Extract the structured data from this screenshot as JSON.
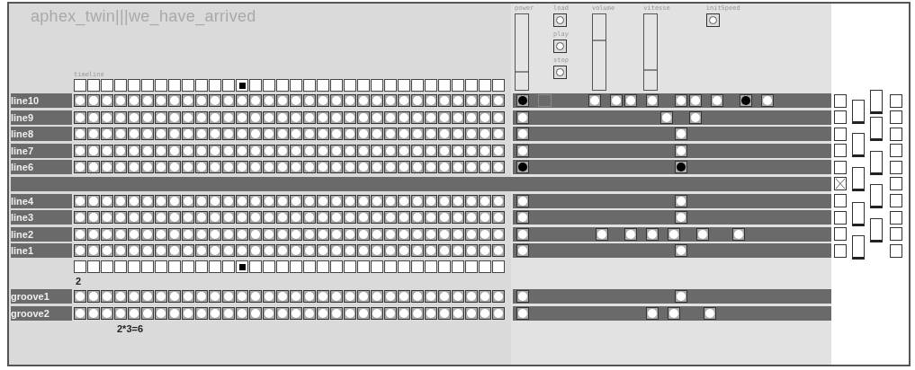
{
  "title": "aphex_twin|||we_have_arrived",
  "timeline": {
    "label": "timeline",
    "steps": [
      false,
      false,
      false,
      false,
      false,
      false,
      false,
      false,
      false,
      false,
      false,
      false,
      true,
      false,
      false,
      false,
      false,
      false,
      false,
      false,
      false,
      false,
      false,
      false,
      false,
      false,
      false,
      false,
      false,
      false,
      false,
      false
    ]
  },
  "controls": [
    {
      "kind": "slider",
      "label": "power",
      "level": 0.23
    },
    {
      "kind": "stack",
      "items": [
        {
          "label": "load"
        },
        {
          "label": "play"
        },
        {
          "label": "stop"
        }
      ]
    },
    {
      "kind": "slider",
      "label": "volume",
      "level": 0.64
    },
    {
      "kind": "slider",
      "label": "vitesse",
      "level": 0.25
    },
    {
      "kind": "stack",
      "items": [
        {
          "label": "initSpeed"
        }
      ]
    }
  ],
  "rows": [
    {
      "label": "line10",
      "steps": [
        false,
        false,
        false,
        false,
        false,
        false,
        false,
        false,
        false,
        false,
        false,
        false,
        false,
        false,
        false,
        false,
        false,
        false,
        false,
        false,
        false,
        false,
        false,
        false,
        false,
        false,
        false,
        false,
        false,
        false,
        false,
        false
      ],
      "power": true,
      "crossed": false,
      "checked": false,
      "cells": [
        {
          "kind": "box"
        },
        {
          "kind": "toggle",
          "on": false
        },
        {
          "kind": "toggle",
          "on": false
        },
        {
          "kind": "toggle",
          "on": false
        },
        {
          "kind": "toggle",
          "on": false
        },
        {
          "kind": "toggle",
          "on": false
        },
        {
          "kind": "toggle",
          "on": false
        },
        {
          "kind": "toggle",
          "on": false
        },
        {
          "kind": "toggle",
          "on": true
        },
        {
          "kind": "toggle",
          "on": false
        }
      ]
    },
    {
      "label": "line9",
      "steps": [
        false,
        false,
        false,
        false,
        false,
        false,
        false,
        false,
        false,
        false,
        false,
        false,
        false,
        false,
        false,
        false,
        false,
        false,
        false,
        false,
        false,
        false,
        false,
        false,
        false,
        false,
        false,
        false,
        false,
        false,
        false,
        false
      ],
      "power": false,
      "crossed": false,
      "checked": false,
      "cells": [
        {
          "kind": "toggle",
          "on": false
        },
        {
          "kind": "toggle",
          "on": false
        }
      ]
    },
    {
      "label": "line8",
      "steps": [
        false,
        false,
        false,
        false,
        false,
        false,
        false,
        false,
        false,
        false,
        false,
        false,
        false,
        false,
        false,
        false,
        false,
        false,
        false,
        false,
        false,
        false,
        false,
        false,
        false,
        false,
        false,
        false,
        false,
        false,
        false,
        false
      ],
      "power": false,
      "crossed": false,
      "checked": false,
      "cells": [
        {
          "kind": "toggle",
          "on": false
        }
      ]
    },
    {
      "label": "line7",
      "steps": [
        false,
        false,
        false,
        false,
        false,
        false,
        false,
        false,
        false,
        false,
        false,
        false,
        false,
        false,
        false,
        false,
        false,
        false,
        false,
        false,
        false,
        false,
        false,
        false,
        false,
        false,
        false,
        false,
        false,
        false,
        false,
        false
      ],
      "power": false,
      "crossed": false,
      "checked": false,
      "cells": [
        {
          "kind": "toggle",
          "on": false
        }
      ]
    },
    {
      "label": "line6",
      "steps": [
        false,
        false,
        false,
        false,
        false,
        false,
        false,
        false,
        false,
        false,
        false,
        false,
        false,
        false,
        false,
        false,
        false,
        false,
        false,
        false,
        false,
        false,
        false,
        false,
        false,
        false,
        false,
        false,
        false,
        false,
        false,
        false
      ],
      "power": true,
      "crossed": false,
      "checked": false,
      "cells": [
        {
          "kind": "toggle",
          "on": true
        }
      ]
    },
    {
      "crossed": true,
      "checked": false
    },
    {
      "label": "line4",
      "steps": [
        false,
        false,
        false,
        false,
        false,
        false,
        false,
        false,
        false,
        false,
        false,
        false,
        false,
        false,
        false,
        false,
        false,
        false,
        false,
        false,
        false,
        false,
        false,
        false,
        false,
        false,
        false,
        false,
        false,
        false,
        false,
        false
      ],
      "power": false,
      "crossed": false,
      "checked": false,
      "cells": [
        {
          "kind": "toggle",
          "on": false
        }
      ]
    },
    {
      "label": "line3",
      "steps": [
        false,
        false,
        false,
        false,
        false,
        false,
        false,
        false,
        false,
        false,
        false,
        false,
        false,
        false,
        false,
        false,
        false,
        false,
        false,
        false,
        false,
        false,
        false,
        false,
        false,
        false,
        false,
        false,
        false,
        false,
        false,
        false
      ],
      "power": false,
      "crossed": false,
      "checked": false,
      "cells": [
        {
          "kind": "toggle",
          "on": false
        }
      ]
    },
    {
      "label": "line2",
      "steps": [
        false,
        false,
        false,
        false,
        false,
        false,
        false,
        false,
        false,
        false,
        false,
        false,
        false,
        false,
        false,
        false,
        false,
        false,
        false,
        false,
        false,
        false,
        false,
        false,
        false,
        false,
        false,
        false,
        false,
        false,
        false,
        false
      ],
      "power": false,
      "crossed": false,
      "checked": false,
      "cells": [
        {
          "kind": "toggle",
          "on": false
        },
        {
          "kind": "toggle",
          "on": false
        },
        {
          "kind": "toggle",
          "on": false
        },
        {
          "kind": "toggle",
          "on": false
        },
        {
          "kind": "toggle",
          "on": false
        },
        {
          "kind": "toggle",
          "on": false
        }
      ]
    },
    {
      "label": "line1",
      "steps": [
        false,
        false,
        false,
        false,
        false,
        false,
        false,
        false,
        false,
        false,
        false,
        false,
        false,
        false,
        false,
        false,
        false,
        false,
        false,
        false,
        false,
        false,
        false,
        false,
        false,
        false,
        false,
        false,
        false,
        false,
        false,
        false
      ],
      "power": false,
      "crossed": false,
      "checked": false,
      "cells": [
        {
          "kind": "toggle",
          "on": false
        }
      ]
    }
  ],
  "timeline_bottom": {
    "steps": [
      false,
      false,
      false,
      false,
      false,
      false,
      false,
      false,
      false,
      false,
      false,
      false,
      true,
      false,
      false,
      false,
      false,
      false,
      false,
      false,
      false,
      false,
      false,
      false,
      false,
      false,
      false,
      false,
      false,
      false,
      false,
      false
    ]
  },
  "counter": "2",
  "grooves": [
    {
      "label": "groove1",
      "steps": [
        false,
        false,
        false,
        false,
        false,
        false,
        false,
        false,
        false,
        false,
        false,
        false,
        false,
        false,
        false,
        false,
        false,
        false,
        false,
        false,
        false,
        false,
        false,
        false,
        false,
        false,
        false,
        false,
        false,
        false,
        false,
        false
      ],
      "power": false,
      "cells": [
        {
          "kind": "toggle",
          "on": false
        }
      ]
    },
    {
      "label": "groove2",
      "steps": [
        false,
        false,
        false,
        false,
        false,
        false,
        false,
        false,
        false,
        false,
        false,
        false,
        false,
        false,
        false,
        false,
        false,
        false,
        false,
        false,
        false,
        false,
        false,
        false,
        false,
        false,
        false,
        false,
        false,
        false,
        false,
        false
      ],
      "power": false,
      "cells": [
        {
          "kind": "toggle",
          "on": false
        },
        {
          "kind": "toggle",
          "on": false
        },
        {
          "kind": "toggle",
          "on": false
        }
      ]
    }
  ],
  "formula": "2*3=6"
}
